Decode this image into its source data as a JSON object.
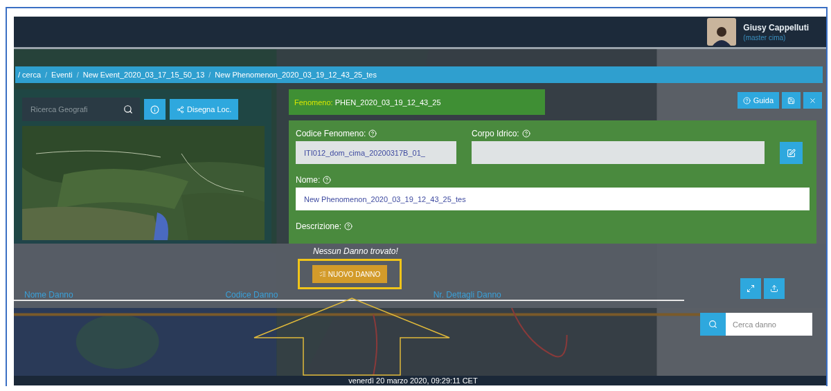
{
  "header": {
    "user_name": "Giusy Cappelluti",
    "user_role": "(master cima)"
  },
  "breadcrumb": {
    "separator": "/",
    "items": [
      "/ cerca",
      "Eventi",
      "New Event_2020_03_17_15_50_13",
      "New Phenomenon_2020_03_19_12_43_25_tes"
    ]
  },
  "geo_search": {
    "placeholder": "Ricerca Geografi"
  },
  "draw_button": "Disegna Loc.",
  "phenomenon": {
    "label": "Fenomeno:",
    "value": "PHEN_2020_03_19_12_43_25"
  },
  "actions": [
    {
      "kind": "help",
      "label": "Guida"
    },
    {
      "kind": "save"
    },
    {
      "kind": "close"
    }
  ],
  "form": {
    "code": {
      "label": "Codice Fenomeno:",
      "value": "ITI012_dom_cima_20200317B_01_"
    },
    "water_body": {
      "label": "Corpo Idrico:"
    },
    "name": {
      "label": "Nome:",
      "value": "New Phenomenon_2020_03_19_12_43_25_tes"
    },
    "description": {
      "label": "Descrizione:"
    }
  },
  "damage": {
    "empty_message": "Nessun Danno trovato!",
    "new_button": "NUOVO DANNO",
    "columns": [
      "Nome Danno",
      "Codice Danno",
      "Nr. Dettagli Danno"
    ],
    "search_placeholder": "Cerca danno"
  },
  "status_bar": "venerdì 20 marzo 2020, 09:29:11 CET"
}
